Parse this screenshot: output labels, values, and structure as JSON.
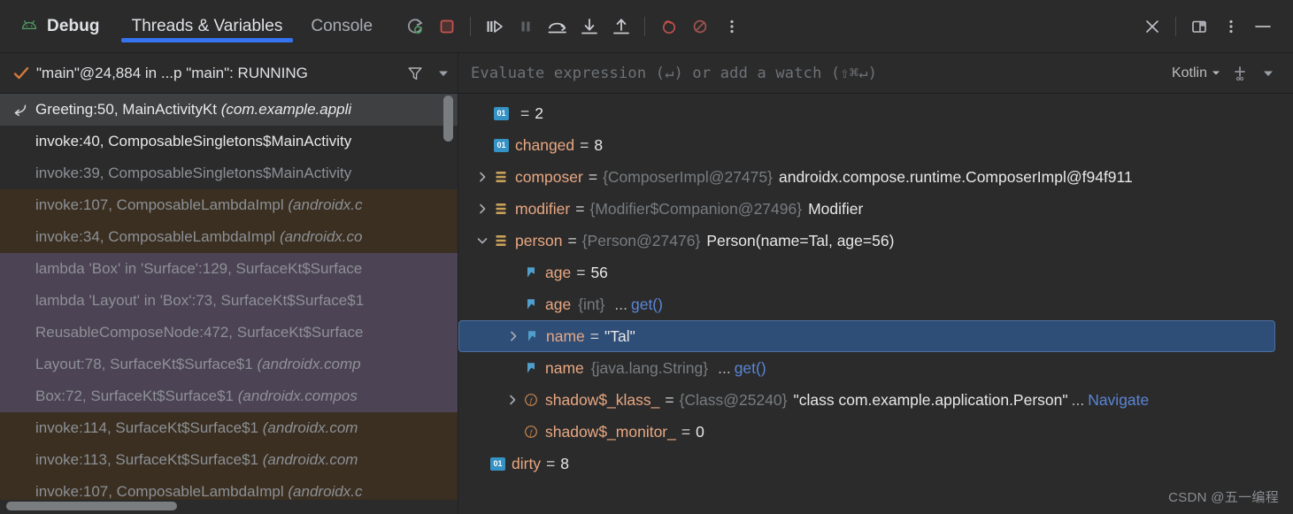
{
  "window": {
    "title": "Debug",
    "android_icon": "android-icon"
  },
  "tabs": [
    {
      "label": "Threads & Variables",
      "active": true
    },
    {
      "label": "Console",
      "active": false
    }
  ],
  "toolbar_icons": [
    {
      "name": "rerun-debug-icon",
      "title": "Rerun"
    },
    {
      "name": "stop-icon",
      "title": "Stop"
    },
    {
      "name": "resume-program-icon",
      "title": "Resume Program"
    },
    {
      "name": "pause-program-icon",
      "title": "Pause Program"
    },
    {
      "name": "step-over-icon",
      "title": "Step Over"
    },
    {
      "name": "step-into-icon",
      "title": "Step Into"
    },
    {
      "name": "step-out-icon",
      "title": "Step Out"
    },
    {
      "name": "view-breakpoints-icon",
      "title": "View Breakpoints"
    },
    {
      "name": "mute-breakpoints-icon",
      "title": "Mute Breakpoints"
    },
    {
      "name": "more-options-icon",
      "title": "More"
    }
  ],
  "window_controls": [
    {
      "name": "close-icon"
    },
    {
      "name": "layout-settings-icon"
    },
    {
      "name": "options-menu-icon"
    },
    {
      "name": "minimize-icon"
    }
  ],
  "thread_selector": {
    "status_text": "\"main\"@24,884 in ...p \"main\": RUNNING",
    "filter_icon": "filter-icon",
    "dropdown_icon": "chevron-down-icon",
    "check_icon": "check-icon"
  },
  "evaluate": {
    "placeholder": "Evaluate expression (↵) or add a watch (⇧⌘↵)",
    "language": "Kotlin",
    "add_watch_icon": "add-watch-icon",
    "dropdown_icon": "chevron-down-icon"
  },
  "frames": [
    {
      "text": "Greeting:50, MainActivityKt ",
      "pkg": "(com.example.appli",
      "style": "sel",
      "tone": "bright",
      "icon": "return-arrow-icon"
    },
    {
      "text": "invoke:40, ComposableSingletons$MainActivity",
      "pkg": "",
      "style": "default",
      "tone": "bright",
      "icon": ""
    },
    {
      "text": "invoke:39, ComposableSingletons$MainActivity",
      "pkg": "",
      "style": "default",
      "tone": "dim",
      "icon": ""
    },
    {
      "text": "invoke:107, ComposableLambdaImpl ",
      "pkg": "(androidx.c",
      "style": "brown",
      "tone": "dim",
      "icon": ""
    },
    {
      "text": "invoke:34, ComposableLambdaImpl ",
      "pkg": "(androidx.co",
      "style": "brown",
      "tone": "dim",
      "icon": ""
    },
    {
      "text": "lambda 'Box' in 'Surface':129, SurfaceKt$Surface",
      "pkg": "",
      "style": "purple",
      "tone": "dim",
      "icon": ""
    },
    {
      "text": "lambda 'Layout' in 'Box':73, SurfaceKt$Surface$1",
      "pkg": "",
      "style": "purple",
      "tone": "dim",
      "icon": ""
    },
    {
      "text": "ReusableComposeNode:472, SurfaceKt$Surface",
      "pkg": "",
      "style": "purple",
      "tone": "dim",
      "icon": ""
    },
    {
      "text": "Layout:78, SurfaceKt$Surface$1 ",
      "pkg": "(androidx.comp",
      "style": "purple",
      "tone": "dim",
      "icon": ""
    },
    {
      "text": "Box:72, SurfaceKt$Surface$1 ",
      "pkg": "(androidx.compos",
      "style": "purple",
      "tone": "dim",
      "icon": ""
    },
    {
      "text": "invoke:114, SurfaceKt$Surface$1 ",
      "pkg": "(androidx.com",
      "style": "brown",
      "tone": "dim",
      "icon": ""
    },
    {
      "text": "invoke:113, SurfaceKt$Surface$1 ",
      "pkg": "(androidx.com",
      "style": "brown",
      "tone": "dim",
      "icon": ""
    },
    {
      "text": "invoke:107, ComposableLambdaImpl ",
      "pkg": "(androidx.c",
      "style": "brown",
      "tone": "dim",
      "icon": ""
    }
  ],
  "variables": [
    {
      "name": "",
      "eq": "=",
      "type": "",
      "value": "2",
      "icon": "primitive-01-icon",
      "twisty": "",
      "indent": 0,
      "selected": false,
      "link": "",
      "ellipsis": ""
    },
    {
      "name": "changed",
      "eq": "=",
      "type": "",
      "value": "8",
      "icon": "primitive-01-icon",
      "twisty": "",
      "indent": 0,
      "selected": false,
      "link": "",
      "ellipsis": ""
    },
    {
      "name": "composer",
      "eq": "=",
      "type": "{ComposerImpl@27475}",
      "value": "androidx.compose.runtime.ComposerImpl@f94f911",
      "icon": "object-icon",
      "twisty": "collapsed",
      "indent": 0,
      "selected": false,
      "link": "",
      "ellipsis": ""
    },
    {
      "name": "modifier",
      "eq": "=",
      "type": "{Modifier$Companion@27496}",
      "value": "Modifier",
      "icon": "object-icon",
      "twisty": "collapsed",
      "indent": 0,
      "selected": false,
      "link": "",
      "ellipsis": ""
    },
    {
      "name": "person",
      "eq": "=",
      "type": "{Person@27476}",
      "value": "Person(name=Tal, age=56)",
      "icon": "object-icon",
      "twisty": "expanded",
      "indent": 0,
      "selected": false,
      "link": "",
      "ellipsis": ""
    },
    {
      "name": "age",
      "eq": "=",
      "type": "",
      "value": "56",
      "icon": "field-icon",
      "twisty": "",
      "indent": 1,
      "selected": false,
      "link": "",
      "ellipsis": ""
    },
    {
      "name": "age",
      "eq": "",
      "type": "{int}",
      "value": "",
      "icon": "field-icon",
      "twisty": "",
      "indent": 1,
      "selected": false,
      "link": "get()",
      "ellipsis": "..."
    },
    {
      "name": "name",
      "eq": "=",
      "type": "",
      "value": "\"Tal\"",
      "icon": "field-icon",
      "twisty": "collapsed",
      "indent": 1,
      "selected": true,
      "link": "",
      "ellipsis": ""
    },
    {
      "name": "name",
      "eq": "",
      "type": "{java.lang.String}",
      "value": "",
      "icon": "field-icon",
      "twisty": "",
      "indent": 1,
      "selected": false,
      "link": "get()",
      "ellipsis": "..."
    },
    {
      "name": "shadow$_klass_",
      "eq": "=",
      "type": "{Class@25240}",
      "value": "\"class com.example.application.Person\"",
      "icon": "synthetic-field-icon",
      "twisty": "collapsed",
      "indent": 1,
      "selected": false,
      "link": "Navigate",
      "ellipsis": "..."
    },
    {
      "name": "shadow$_monitor_",
      "eq": "=",
      "type": "",
      "value": "0",
      "icon": "synthetic-field-icon",
      "twisty": "",
      "indent": 1,
      "selected": false,
      "link": "",
      "ellipsis": ""
    },
    {
      "name": "dirty",
      "eq": "=",
      "type": "",
      "value": "8",
      "icon": "primitive-01-icon",
      "twisty": "",
      "indent": -1,
      "selected": false,
      "link": "",
      "ellipsis": ""
    }
  ],
  "watermark": "CSDN @五一编程",
  "colors": {
    "background": "#2B2B2B",
    "accent_tab": "#3574F0",
    "selection_frame": "#3E4042",
    "selection_var": "#2F4E77",
    "row_brown": "#3A2F21",
    "row_purple": "#4C4354",
    "var_name": "#E8A782",
    "var_type": "#787C80",
    "link": "#5A85D6",
    "android_green": "#3DDC84",
    "stop_red": "#C75450",
    "check_orange": "#D5783C"
  }
}
